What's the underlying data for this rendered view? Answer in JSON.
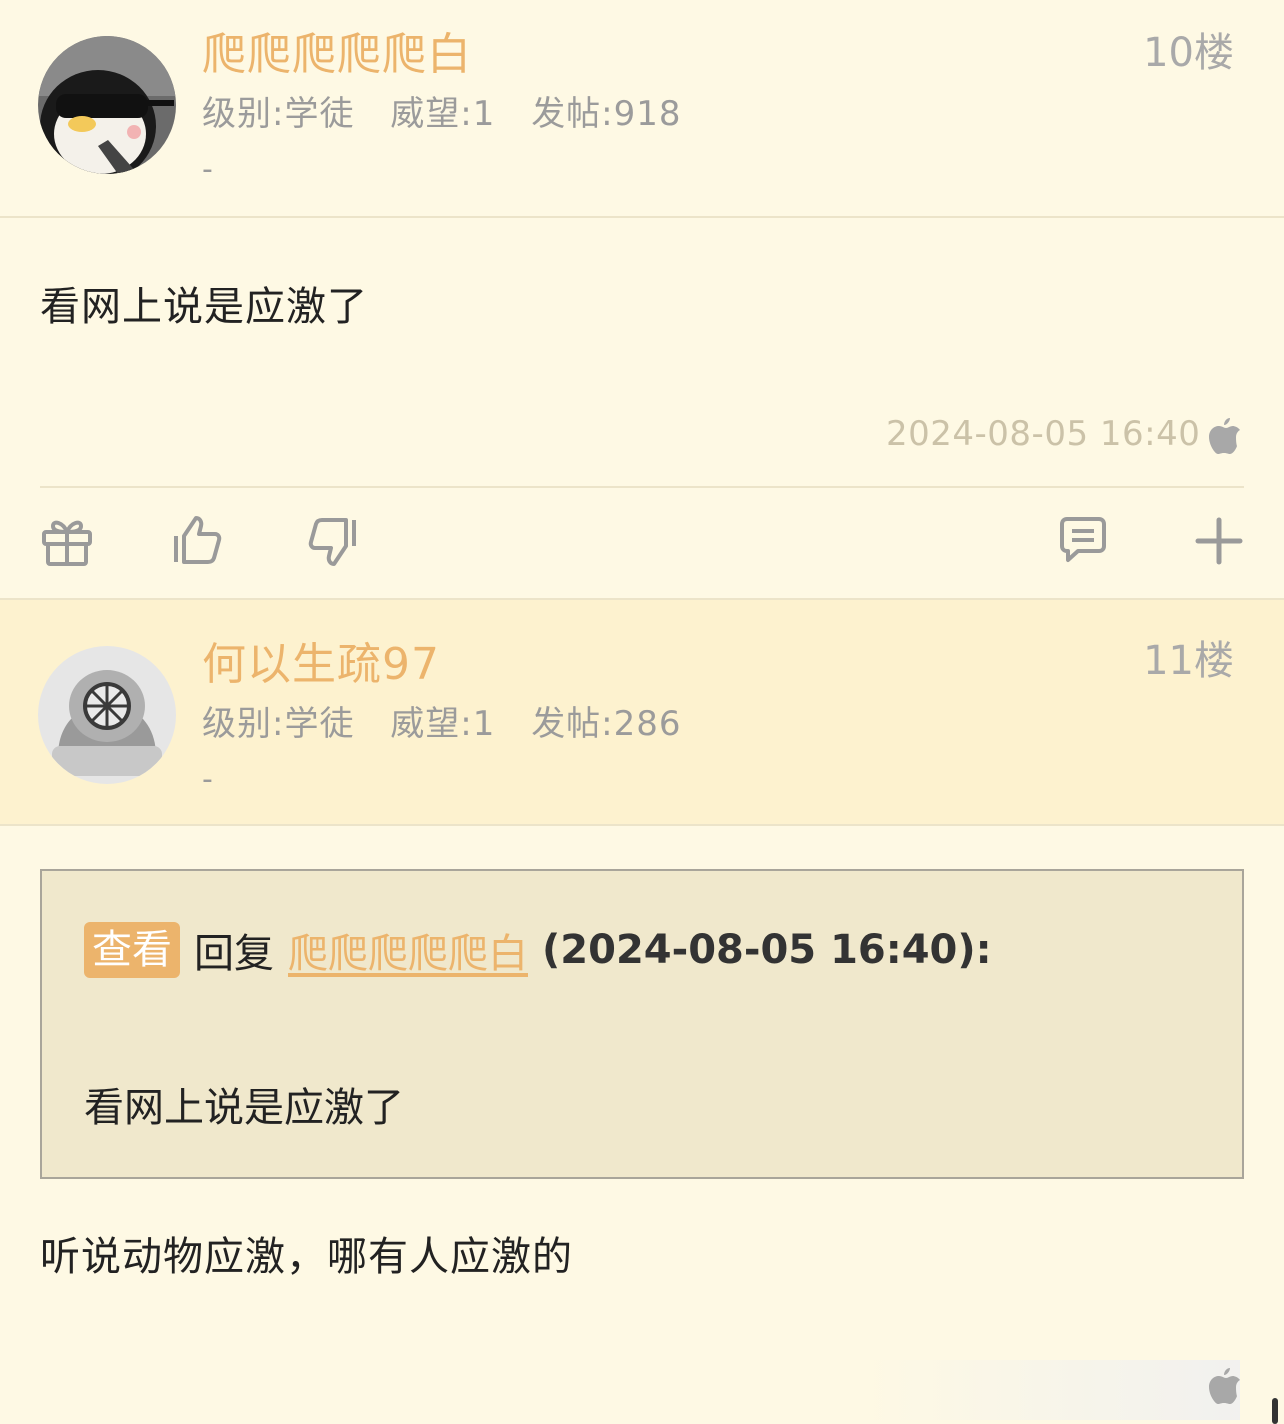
{
  "posts": [
    {
      "username": "爬爬爬爬爬白",
      "level": "级别:学徒",
      "prestige": "威望:1",
      "post_count": "发帖:918",
      "signature": "-",
      "floor": "10楼",
      "content": "看网上说是应激了",
      "time": "2024-08-05 16:40",
      "device_icon": "apple-icon",
      "actions": [
        "gift-icon",
        "thumbs-up-icon",
        "thumbs-down-icon",
        "comment-icon",
        "plus-icon"
      ]
    },
    {
      "username": "何以生疏97",
      "level": "级别:学徒",
      "prestige": "威望:1",
      "post_count": "发帖:286",
      "signature": "-",
      "floor": "11楼",
      "quote": {
        "view_label": "查看",
        "reply_word": "回复",
        "quoted_user": "爬爬爬爬爬白",
        "quoted_time": "(2024-08-05 16:40):",
        "quoted_text": "看网上说是应激了"
      },
      "content": "听说动物应激，哪有人应激的",
      "device_icon": "apple-icon"
    }
  ],
  "colors": {
    "background": "#fef9e4",
    "header_alt": "#fdf2cf",
    "username": "#ecb46c",
    "meta": "#9b9b9b",
    "quote_bg": "#f0e8cc"
  }
}
